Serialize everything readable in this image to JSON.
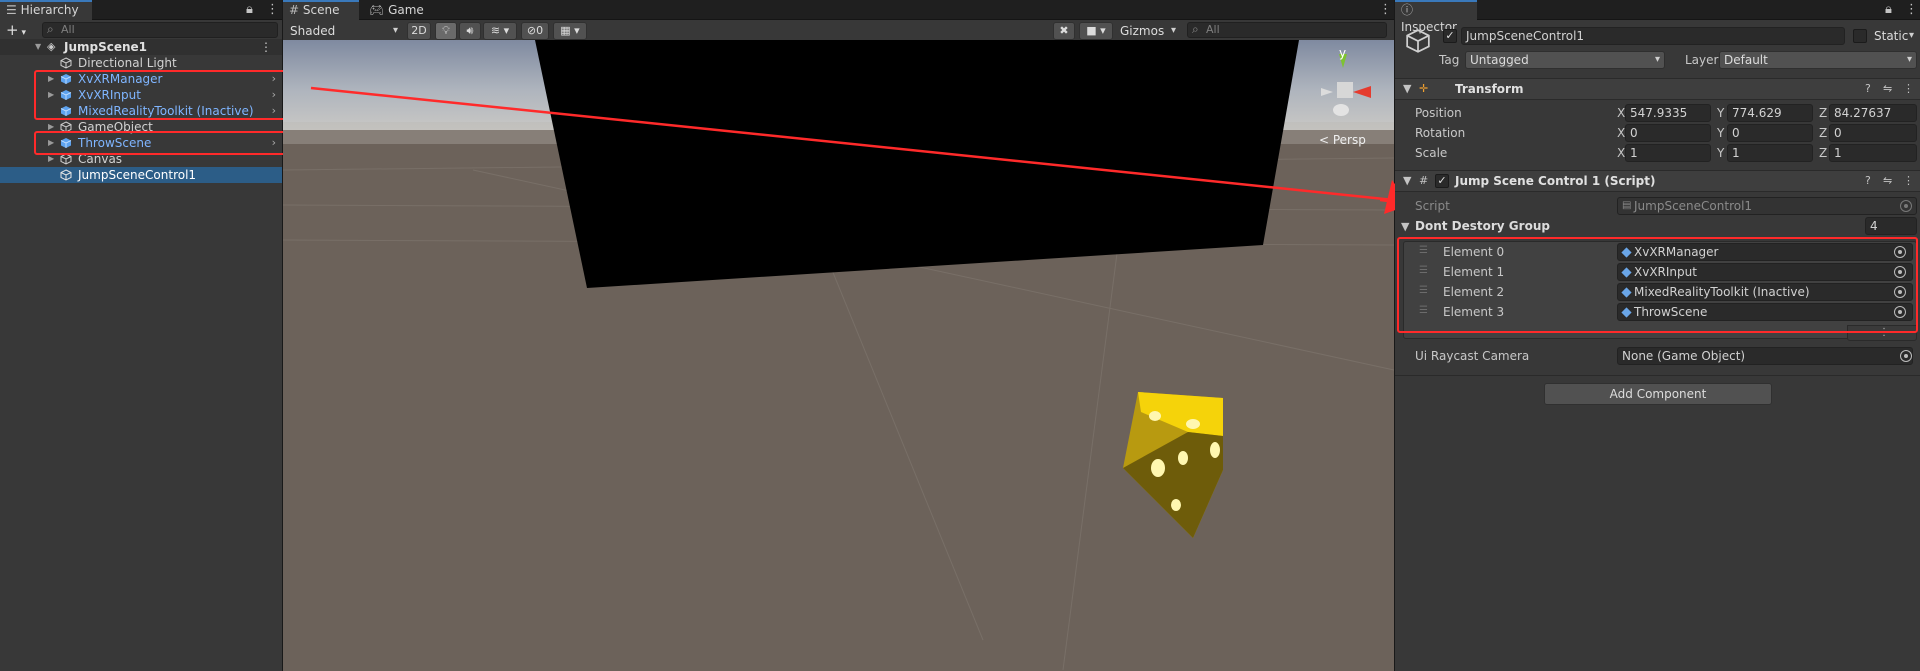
{
  "hierarchy": {
    "tab_label": "Hierarchy",
    "search_placeholder": "All",
    "add_label": "+",
    "scene_name": "JumpScene1",
    "items": [
      {
        "label": "Directional Light"
      },
      {
        "label": "XvXRManager"
      },
      {
        "label": "XvXRInput"
      },
      {
        "label": "MixedRealityToolkit (Inactive)"
      },
      {
        "label": "GameObject"
      },
      {
        "label": "ThrowScene"
      },
      {
        "label": "Canvas"
      },
      {
        "label": "JumpSceneControl1"
      }
    ]
  },
  "scene_view": {
    "tabs": [
      {
        "label": "Scene"
      },
      {
        "label": "Game"
      }
    ],
    "shading_mode": "Shaded",
    "mode_2d": "2D",
    "hidden_count": "0",
    "gizmos_label": "Gizmos",
    "search_placeholder": "All",
    "gizmo_axis_label": "y",
    "projection_label": "< Persp"
  },
  "inspector": {
    "tab_label": "Inspector",
    "object_name": "JumpSceneControl1",
    "static_label": "Static",
    "tag_label": "Tag",
    "tag_value": "Untagged",
    "layer_label": "Layer",
    "layer_value": "Default",
    "transform": {
      "title": "Transform",
      "position_label": "Position",
      "rotation_label": "Rotation",
      "scale_label": "Scale",
      "axis_x": "X",
      "axis_y": "Y",
      "axis_z": "Z",
      "position": {
        "x": "547.9335",
        "y": "774.629",
        "z": "84.27637"
      },
      "rotation": {
        "x": "0",
        "y": "0",
        "z": "0"
      },
      "scale": {
        "x": "1",
        "y": "1",
        "z": "1"
      }
    },
    "script_component": {
      "title": "Jump Scene Control 1 (Script)",
      "script_label": "Script",
      "script_value": "JumpSceneControl1",
      "group_label": "Dont Destory Group",
      "group_count": "4",
      "elements": [
        {
          "label": "Element 0",
          "value": "XvXRManager"
        },
        {
          "label": "Element 1",
          "value": "XvXRInput"
        },
        {
          "label": "Element 2",
          "value": "MixedRealityToolkit (Inactive)"
        },
        {
          "label": "Element 3",
          "value": "ThrowScene"
        }
      ],
      "raycast_label": "Ui Raycast Camera",
      "raycast_value": "None (Game Object)"
    },
    "add_component_label": "Add Component"
  },
  "colors": {
    "annotation_red": "#ff2a2a",
    "selection_blue": "#2c5d87",
    "prefab_blue": "#7fb5ff"
  }
}
